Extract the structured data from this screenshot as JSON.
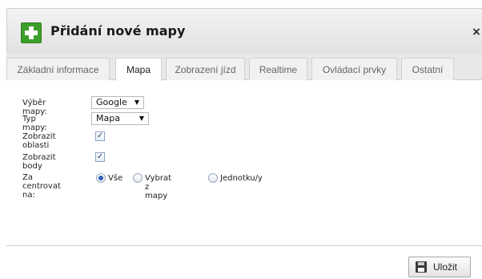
{
  "dialog": {
    "title": "Přidání nové mapy",
    "close_glyph": "×",
    "icon": "add-plus-icon",
    "accent": "#3c9f2a"
  },
  "tabs": [
    {
      "label": "Základní informace",
      "active": false
    },
    {
      "label": "Mapa",
      "active": true
    },
    {
      "label": "Zobrazení jízd",
      "active": false
    },
    {
      "label": "Realtime",
      "active": false
    },
    {
      "label": "Ovládací prvky",
      "active": false
    },
    {
      "label": "Ostatní",
      "active": false
    }
  ],
  "form": {
    "map_select": {
      "label": "Výběr mapy:",
      "value": "Google"
    },
    "map_type": {
      "label": "Typ mapy:",
      "value": "Mapa"
    },
    "show_areas": {
      "label": "Zobrazit oblasti",
      "checked": true
    },
    "show_points": {
      "label": "Zobrazit body",
      "checked": true
    },
    "center": {
      "label": "Za centrovat na:",
      "options": [
        {
          "label": "Vše",
          "checked": true
        },
        {
          "label": "Vybrat z mapy",
          "checked": false
        },
        {
          "label": "Jednotku/y",
          "checked": false
        }
      ]
    }
  },
  "footer": {
    "save_label": "Uložit",
    "save_icon": "floppy-disk-icon"
  }
}
